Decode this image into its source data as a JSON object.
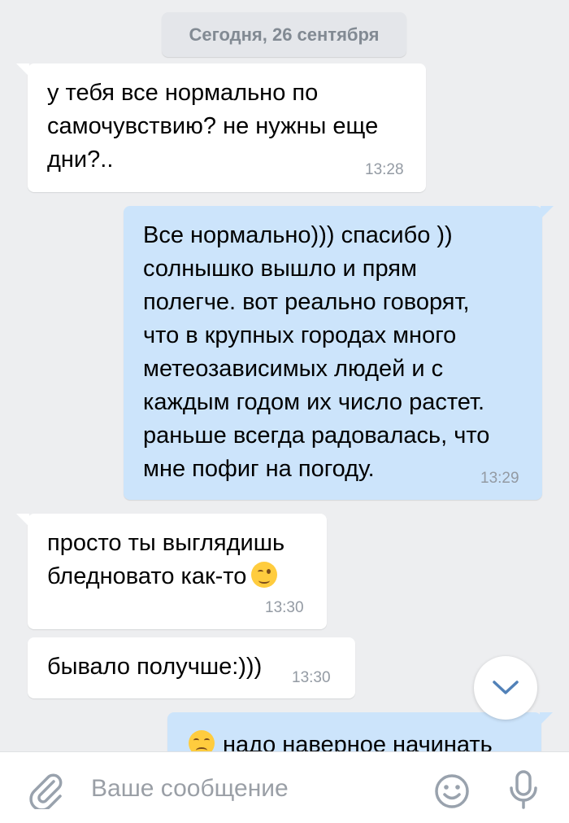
{
  "date_separator": "Сегодня, 26 сентября",
  "messages": [
    {
      "direction": "incoming",
      "text": "у тебя все нормально по\nсамочувствию? не нужны еще\nдни?..",
      "time": "13:28"
    },
    {
      "direction": "outgoing",
      "text": "Все нормально))) спасибо ))\nсолнышко вышло и прям\nполегче. вот реально говорят,\nчто в крупных городах много\nметеозависимых людей и с\nкаждым годом их число растет.\nраньше всегда радовалась, что\nмне пофиг на погоду.",
      "time": "13:29"
    },
    {
      "direction": "incoming",
      "text": "просто ты выглядишь\nбледновато как-то",
      "emoji": "winking-face",
      "time": "13:30"
    },
    {
      "direction": "incoming",
      "text": "бывало получше:)))",
      "time": "13:30"
    },
    {
      "direction": "outgoing",
      "text": "надо наверное начинать",
      "emoji": "unamused-face",
      "time": ""
    }
  ],
  "scroll_button": {
    "icon": "chevron-down-icon"
  },
  "composer": {
    "placeholder": "Ваше сообщение",
    "attach_icon": "paperclip-icon",
    "emoji_icon": "smile-icon",
    "voice_icon": "microphone-icon"
  },
  "colors": {
    "background": "#edeef0",
    "incoming_bubble": "#ffffff",
    "outgoing_bubble": "#cce4fb",
    "icon": "#99a2ad",
    "accent": "#5181b8"
  }
}
